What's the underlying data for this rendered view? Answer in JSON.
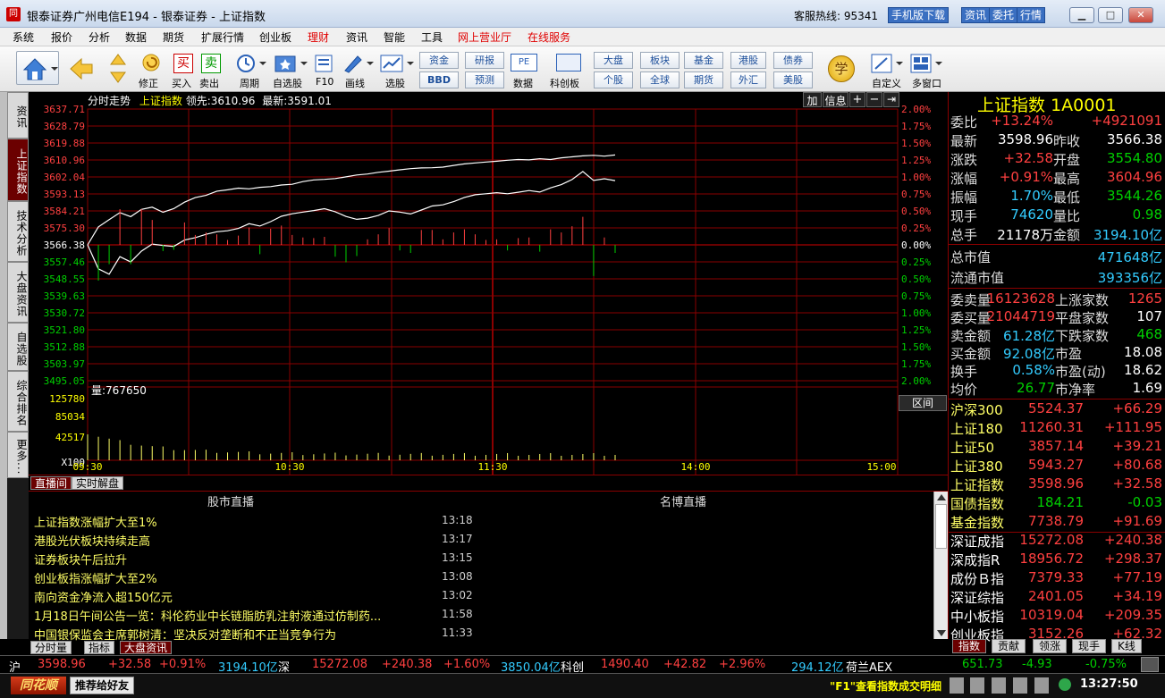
{
  "window": {
    "title": "银泰证券广州电信E194 - 银泰证券 - 上证指数",
    "hotline_label": "客服热线:",
    "hotline": "95341",
    "buttons": [
      "手机版下载",
      "资讯",
      "委托",
      "行情"
    ]
  },
  "menu": [
    "系统",
    "报价",
    "分析",
    "数据",
    "期货",
    "扩展行情",
    "创业板",
    "理财",
    "资讯",
    "智能",
    "工具",
    "网上营业厅",
    "在线服务"
  ],
  "toolbar": {
    "buttons": [
      "修正",
      "买入",
      "卖出",
      "周期",
      "自选股",
      "F10",
      "画线",
      "选股",
      "数据",
      "科创板",
      "自定义",
      "多窗口"
    ],
    "small": [
      "资金",
      "研报",
      "BBD",
      "预测",
      "大盘",
      "板块",
      "基金",
      "港股",
      "债券",
      "个股",
      "全球",
      "期货",
      "外汇",
      "美股"
    ],
    "learn": "学"
  },
  "left_tabs": [
    "资讯",
    "上证指数",
    "技术分析",
    "大盘资讯",
    "自选股",
    "综合排名",
    "更多..."
  ],
  "chart": {
    "head": "分时走势",
    "index_label": "上证指数",
    "lead_label": "领先:",
    "lead": "3610.96",
    "latest_label": "最新:",
    "latest": "3591.01",
    "tools": [
      "加",
      "信息",
      "+",
      "−",
      "⇥"
    ],
    "vol_label": "量:",
    "vol": "767650",
    "zone": "区间"
  },
  "chart_data": {
    "type": "line",
    "prev_close": 3566.38,
    "y_ticks": [
      "3637.71",
      "3628.79",
      "3619.88",
      "3610.96",
      "3602.04",
      "3593.13",
      "3584.21",
      "3575.30",
      "3566.38",
      "3557.46",
      "3548.55",
      "3539.63",
      "3530.72",
      "3521.80",
      "3512.88",
      "3503.97",
      "3495.05"
    ],
    "pct_ticks": [
      "2.00%",
      "1.75%",
      "1.50%",
      "1.25%",
      "1.00%",
      "0.75%",
      "0.50%",
      "0.25%",
      "0.00%",
      "0.25%",
      "0.50%",
      "0.75%",
      "1.00%",
      "1.25%",
      "1.50%",
      "1.75%",
      "2.00%"
    ],
    "vol_ticks": [
      "125780",
      "85034",
      "42517",
      "X100"
    ],
    "x_ticks": [
      "09:30",
      "10:30",
      "11:30",
      "14:00",
      "15:00"
    ],
    "series": [
      {
        "values": [
          3566.4,
          3575.8,
          3579.6,
          3583.3,
          3581.2,
          3585.0,
          3586.2,
          3583.5,
          3585.4,
          3588.8,
          3591.2,
          3592.4,
          3594.6,
          3595.3,
          3596.2,
          3595.8,
          3596.6,
          3597.0,
          3597.8,
          3598.2,
          3599.6,
          3600.5,
          3600.8,
          3601.2,
          3602.1,
          3603.1,
          3603.6,
          3604.5,
          3605.1,
          3605.8,
          3606.4,
          3606.8,
          3606.9,
          3607.2,
          3608.1,
          3608.9,
          3609.4,
          3609.9,
          3610.3,
          3610.8,
          3611.2,
          3611.0,
          3611.6,
          3611.2,
          3612.1,
          3612.6,
          3613.1,
          3613.4,
          3613.0,
          3613.6
        ]
      },
      {
        "values": [
          3566.4,
          3553.8,
          3551.0,
          3560.2,
          3557.4,
          3563.1,
          3566.8,
          3566.1,
          3565.6,
          3568.9,
          3570.2,
          3571.9,
          3573.3,
          3573.8,
          3575.0,
          3577.5,
          3576.3,
          3578.6,
          3581.4,
          3582.7,
          3583.6,
          3584.4,
          3585.4,
          3583.8,
          3581.3,
          3579.8,
          3580.4,
          3581.8,
          3584.2,
          3583.6,
          3582.6,
          3584.7,
          3586.8,
          3587.4,
          3589.1,
          3591.3,
          3592.7,
          3593.2,
          3593.8,
          3593.2,
          3594.0,
          3594.9,
          3594.1,
          3596.3,
          3598.0,
          3600.7,
          3604.9,
          3600.2,
          3601.1,
          3600.1
        ]
      }
    ]
  },
  "quote": {
    "name": "上证指数",
    "code": "1A0001",
    "rows": [
      {
        "l": "委比",
        "v": "+13.24%",
        "l2": "",
        "v2": "+4921091"
      },
      {
        "l": "最新",
        "v": "3598.96",
        "l2": "昨收",
        "v2": "3566.38"
      },
      {
        "l": "涨跌",
        "v": "+32.58",
        "l2": "开盘",
        "v2": "3554.80"
      },
      {
        "l": "涨幅",
        "v": "+0.91%",
        "l2": "最高",
        "v2": "3604.96"
      },
      {
        "l": "振幅",
        "v": "1.70%",
        "l2": "最低",
        "v2": "3544.26"
      },
      {
        "l": "现手",
        "v": "74620",
        "l2": "量比",
        "v2": "0.98"
      },
      {
        "l": "总手",
        "v": "21178万",
        "l2": "金额",
        "v2": "3194.10亿"
      }
    ],
    "mv": [
      {
        "l": "总市值",
        "v": "471648亿"
      },
      {
        "l": "流通市值",
        "v": "393356亿"
      }
    ],
    "orders": [
      {
        "l": "委卖量",
        "v": "16123628",
        "l2": "上涨家数",
        "v2": "1265"
      },
      {
        "l": "委买量",
        "v": "21044719",
        "l2": "平盘家数",
        "v2": "107"
      },
      {
        "l": "卖金额",
        "v": "61.28亿",
        "l2": "下跌家数",
        "v2": "468"
      },
      {
        "l": "买金额",
        "v": "92.08亿",
        "l2": "市盈",
        "v2": "18.08"
      },
      {
        "l": "换手",
        "v": "0.58%",
        "l2": "市盈(动)",
        "v2": "18.62"
      },
      {
        "l": "均价",
        "v": "26.77",
        "l2": "市净率",
        "v2": "1.69"
      }
    ],
    "indices": [
      {
        "n": "沪深300",
        "p": "5524.37",
        "c": "+66.29"
      },
      {
        "n": "上证180",
        "p": "11260.31",
        "c": "+111.95"
      },
      {
        "n": "上证50",
        "p": "3857.14",
        "c": "+39.21"
      },
      {
        "n": "上证380",
        "p": "5943.27",
        "c": "+80.68"
      },
      {
        "n": "上证指数",
        "p": "3598.96",
        "c": "+32.58"
      },
      {
        "n": "国债指数",
        "p": "184.21",
        "c": "-0.03"
      },
      {
        "n": "基金指数",
        "p": "7738.79",
        "c": "+91.69"
      },
      {
        "n": "深证成指",
        "p": "15272.08",
        "c": "+240.38"
      },
      {
        "n": "深成指R",
        "p": "18956.72",
        "c": "+298.37"
      },
      {
        "n": "成份Ｂ指",
        "p": "7379.33",
        "c": "+77.19"
      },
      {
        "n": "深证综指",
        "p": "2401.05",
        "c": "+34.19"
      },
      {
        "n": "中小板指",
        "p": "10319.04",
        "c": "+209.35"
      },
      {
        "n": "创业板指",
        "p": "3152.26",
        "c": "+62.32"
      }
    ],
    "tabs": [
      "指数",
      "贡献",
      "领涨",
      "现手",
      "K线"
    ]
  },
  "news": {
    "tabs": [
      "直播间",
      "实时解盘"
    ],
    "col1": "股市直播",
    "col2": "名博直播",
    "items": [
      {
        "t": "上证指数涨幅扩大至1%",
        "time": "13:18"
      },
      {
        "t": "港股光伏板块持续走高",
        "time": "13:17"
      },
      {
        "t": "证券板块午后拉升",
        "time": "13:15"
      },
      {
        "t": "创业板指涨幅扩大至2%",
        "time": "13:08"
      },
      {
        "t": "南向资金净流入超150亿元",
        "time": "13:02"
      },
      {
        "t": "1月18日午间公告一览：科伦药业中长链脂肪乳注射液通过仿制药...",
        "time": "11:58"
      },
      {
        "t": "中国银保监会主席郭树清：坚决反对垄断和不正当竞争行为",
        "time": "11:33"
      }
    ],
    "bottom_tabs": [
      "分时量",
      "指标",
      "大盘资讯"
    ]
  },
  "status": {
    "sh_label": "沪",
    "sh": "3598.96",
    "sh_chg": "+32.58",
    "sh_pct": "+0.91%",
    "sh_amt": "3194.10亿",
    "sz_label": "深",
    "sz": "15272.08",
    "sz_chg": "+240.38",
    "sz_pct": "+1.60%",
    "sz_amt": "3850.04亿",
    "kc_label": "科创",
    "kc": "1490.40",
    "kc_chg": "+42.82",
    "kc_pct": "+2.96%",
    "kc_amt": "294.12亿",
    "aex_label": "荷兰AEX",
    "aex": "651.73",
    "aex_chg": "-4.93",
    "aex_pct": "-0.75%"
  },
  "bottom": {
    "logo": "同花顺",
    "recommend": "推荐给好友",
    "tip": "\"F1\"查看指数成交明细",
    "time": "13:27:50"
  },
  "colors": {
    "up": "#ff4040",
    "down": "#00d000",
    "grid": "#8a0000",
    "yellow": "#ffff00",
    "cyan": "#33ccff"
  }
}
